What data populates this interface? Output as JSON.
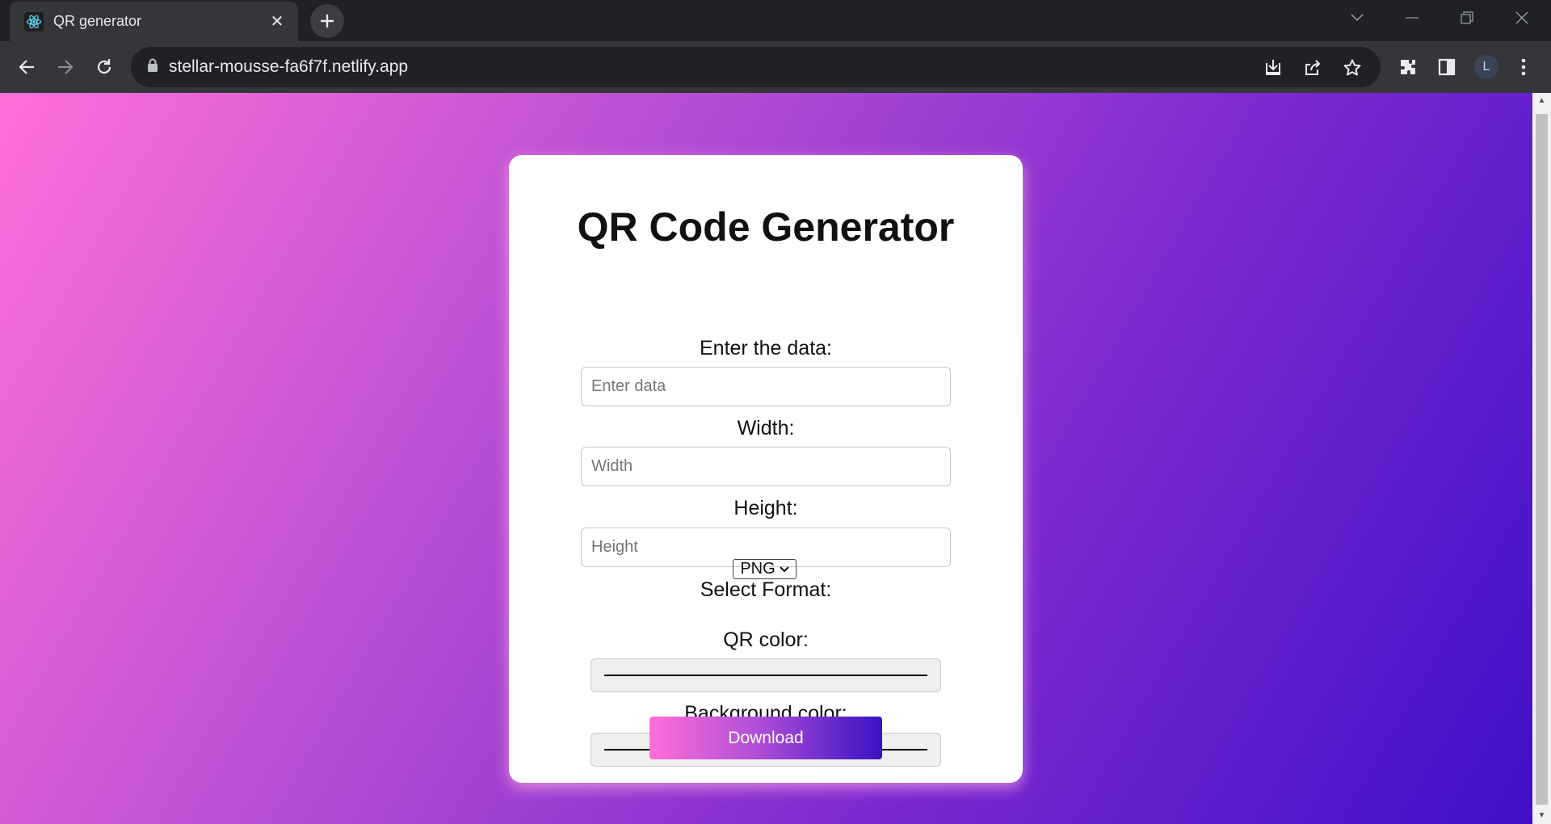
{
  "browser": {
    "tab_title": "QR generator",
    "url": "stellar-mousse-fa6f7f.netlify.app",
    "profile_initial": "L"
  },
  "page": {
    "heading": "QR Code Generator",
    "data_label": "Enter the data:",
    "data_placeholder": "Enter data",
    "width_label": "Width:",
    "width_placeholder": "Width",
    "height_label": "Height:",
    "height_placeholder": "Height",
    "format_label": "Select Format:",
    "format_selected": "PNG",
    "qr_color_label": "QR color:",
    "qr_color_value": "#000000",
    "bg_color_label": "Background color:",
    "bg_color_value": "#000000",
    "download_label": "Download"
  },
  "colors": {
    "gradient_start": "#ff6fd8",
    "gradient_end": "#3813c2"
  }
}
